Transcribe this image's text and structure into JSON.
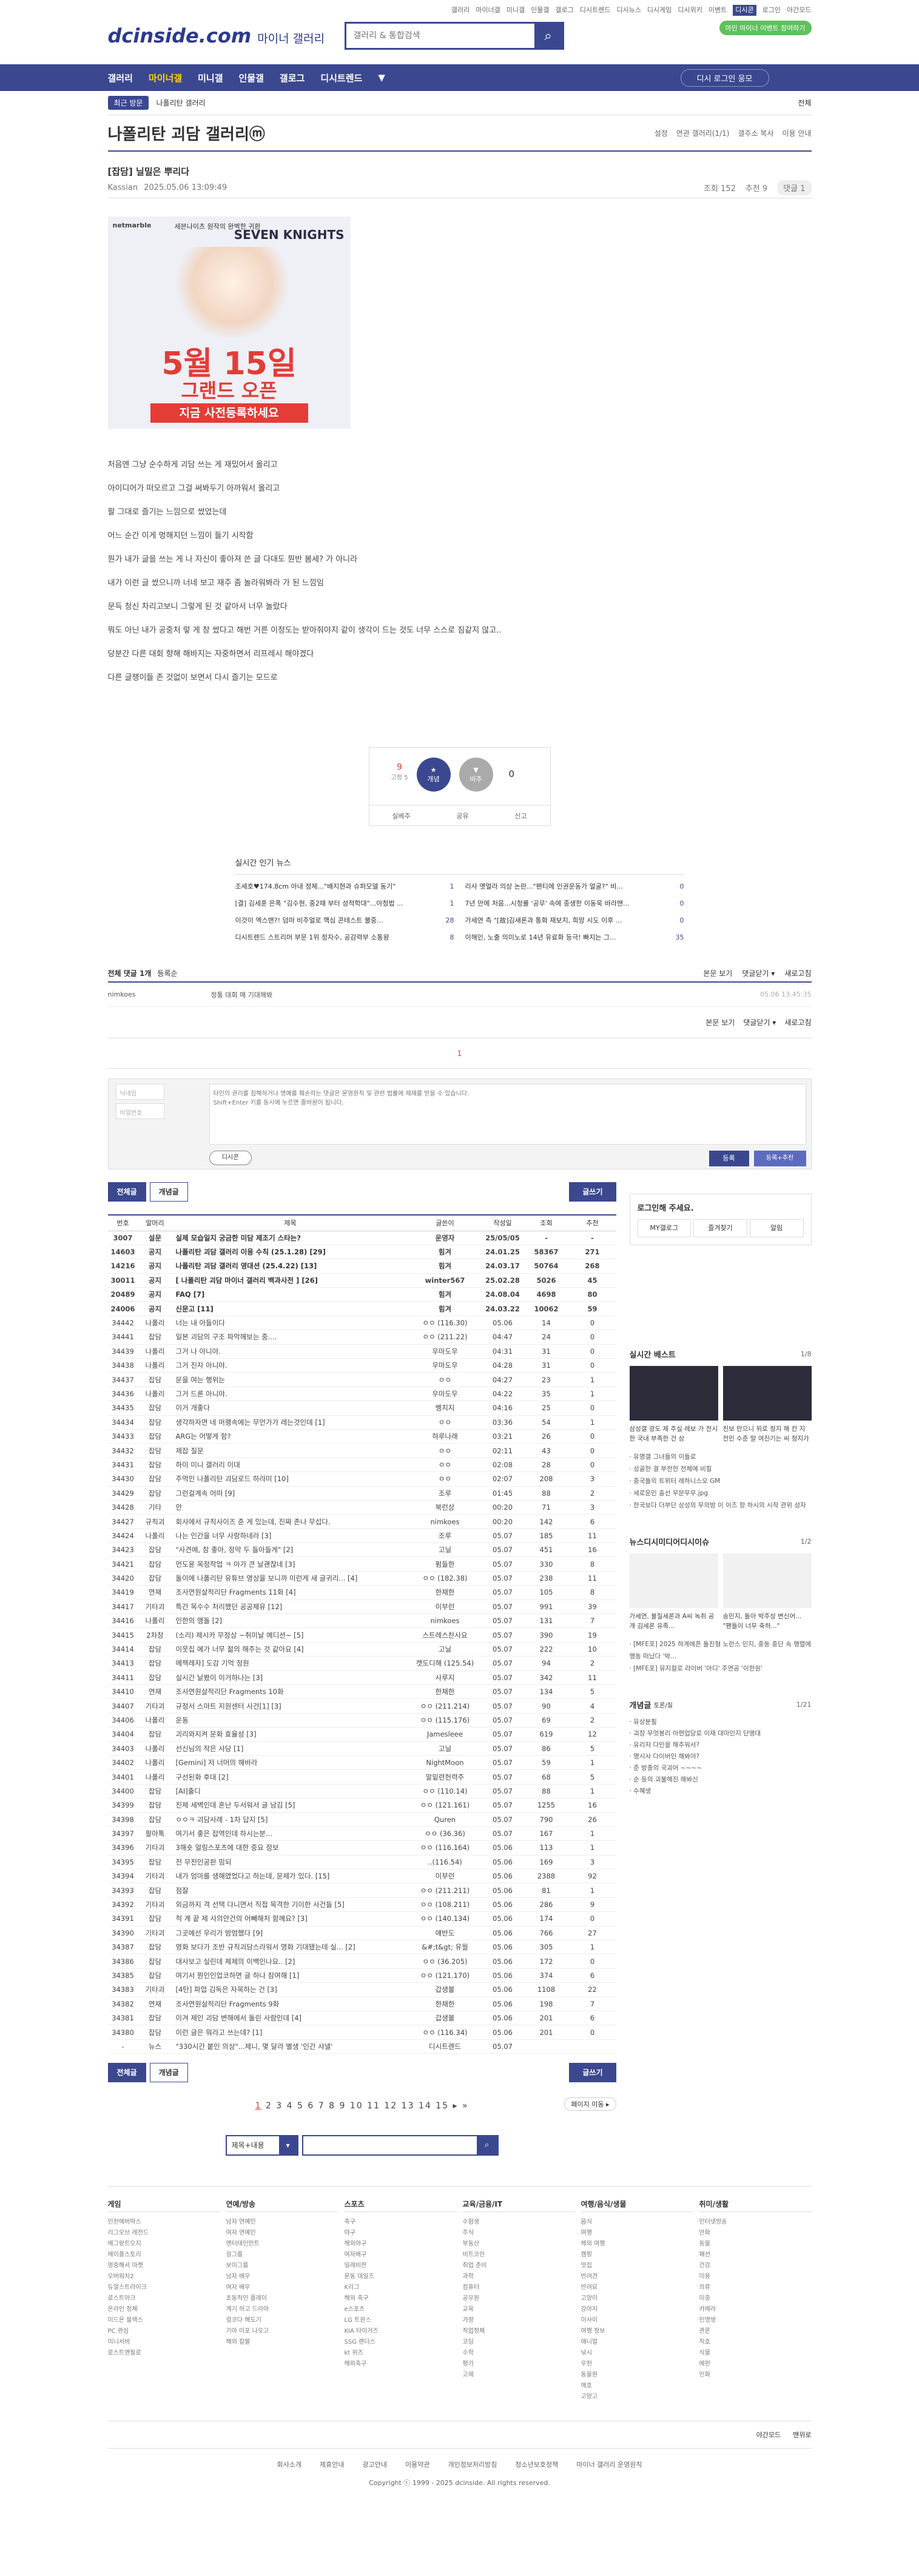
{
  "util": [
    "갤러리",
    "마이너갤",
    "미니갤",
    "인물갤",
    "갤로그",
    "디시트렌드",
    "디시뉴스",
    "디시게임",
    "디시위키",
    "이벤트",
    "디시콘",
    "로그인",
    "야간모드"
  ],
  "logo": "dcinside.com",
  "logo_sub": "마이너 갤러리",
  "search_placeholder": "갤러리 & 통합검색",
  "promo": "마인 마이너 이벤트 참여하기",
  "gnb": [
    "갤러리",
    "마이너갤",
    "미니갤",
    "인물갤",
    "갤로그",
    "디시트렌드"
  ],
  "gnb_login": "디시 로그인 응모",
  "subbar": {
    "tag": "최근 방문",
    "item": "나폴리탄 갤러리",
    "right": "전체"
  },
  "gallery_title": "나폴리탄 괴담 갤러리ⓜ",
  "gallery_opts": [
    "설정",
    "연관 갤러리(1/1)",
    "갤주소 복사",
    "이용 안내"
  ],
  "post": {
    "title": "[잡담] 닐밀은 뿌리다",
    "author": "Kassian",
    "date": "2025.05.06 13:09:49",
    "views": "조회 152",
    "reco": "추천 9",
    "comments": "댓글 1"
  },
  "ad": {
    "label": "netmarble",
    "sub": "세븐나이츠 원작의 완벽한 귀환",
    "brand": "SEVEN KNIGHTS",
    "date": "5월 15일",
    "line": "그랜드 오픈",
    "cta": "지금 사전등록하세요"
  },
  "body": [
    "처음엔 그냥 순수하게 괴담 쓰는 게 재밌어서 올리고",
    "아이디어가 떠오르고 그걸 써봐두기 아까워서 올리고",
    "팔 그대로 즐기는 느낌으로 썼었는데",
    "어느 순간 이게 멍해지던 느낌이 들기 시작함",
    "뭔가 내가 글을 쓰는 게 나 자신이 좋아져 쓴 글 다대도 뭔반 봄세? 가 아니라",
    "내가 이런 글 썼으니까 너네 보고 재주 좀 놀라워봐라 가 된 느낌임",
    "문득 청신 차리고보니 그렇게 된 것 같아서 너무 놀랐다",
    "뭐도 아닌 내가 공중처 렇 게 창 썼다고 해번 거른 이정도는 받아줘야지 같이 생각이 드는 것도 너무 스스로 짐같지 않고..",
    "당분간 다른 대회 향해 해바지는 자중하면서 리프레시 해야겠다",
    "다른 글쟁이들 존 것없이 보면서 다시 즐기는 모드로"
  ],
  "reco": {
    "up": "9",
    "fix": "고정 5",
    "b1": "개념",
    "b2": "비추",
    "down": "0",
    "share": [
      "실베추",
      "공유",
      "신고"
    ]
  },
  "news_title": "실시간 인기 뉴스",
  "news": [
    {
      "t": "조세호♥174.8cm 아내 정체...\"배지현과 슈퍼모델 동기\"",
      "c": "1"
    },
    {
      "t": "리사 옛얼라 의상 논란...\"팬티에 인권운동가 얼굴?\" 비...",
      "c": "0"
    },
    {
      "t": "[결] 김세훈 은폭 \"김수현, 중2때 부터 성적학대\"...아청법 ...",
      "c": "1"
    },
    {
      "t": "7년 만에 처음...시청률 '공무' 속에 종생한 이동욱 바라맨...",
      "c": "0"
    },
    {
      "t": "이것이 엑스맨?! 덤마 비주얼로 핵심 콘테스트 불중...",
      "c": "28"
    },
    {
      "t": "가세연 측 \"[故]김새론과 통화 재보지, 희망 시도 이후 ...",
      "c": "0"
    },
    {
      "t": "디시트렌드 스트리머 부문 1위 정자수, 공감력부 소통왕",
      "c": "8"
    },
    {
      "t": "이해인, 노출 의미노로 14년 유료화 등극! 빠지는 그...",
      "c": "35"
    }
  ],
  "cm": {
    "label": "전체 댓글 1개",
    "sort": "등록순",
    "r": [
      "본문 보기",
      "댓글닫기 ▾",
      "새로고침"
    ],
    "writer": "nimkoes",
    "text": "정통 대회 매 기대해봐",
    "date": "05.06 13:45:35",
    "page": "1"
  },
  "form": {
    "nick": "닉네임",
    "pw": "비밀번호",
    "text": "타인의 권리를 침해하거나 명예를 훼손하는 댓글은 운영원칙 및 관련 법률에 제재를 받을 수 있습니다.\nShift+Enter 키를 동시에 누르면 줄바꿈이 됩니다.",
    "dc": "디시콘",
    "reg": "등록",
    "reg2": "등록+추천"
  },
  "tabs": [
    "전체글",
    "개념글"
  ],
  "write": "글쓰기",
  "cols": [
    "번호",
    "말머리",
    "제목",
    "글쓴이",
    "작성일",
    "조회",
    "추천"
  ],
  "rows": [
    [
      "3007",
      "설문",
      "실제 모습일지 궁금한 미담 제조기 스타는?",
      "운영자",
      "25/05/05",
      "-",
      "-"
    ],
    [
      "14603",
      "공지",
      "나폴리탄 괴담 갤러리 이용 수칙 (25.1.28) [29]",
      "힘겨",
      "24.01.25",
      "58367",
      "271"
    ],
    [
      "14216",
      "공지",
      "나폴리탄 괴담 갤러리 영대션 (25.4.22) [13]",
      "힘겨",
      "24.03.17",
      "50764",
      "268"
    ],
    [
      "30011",
      "공지",
      "[ 나폴리탄 괴담 마이너 갤러리 백과사전 ] [26]",
      "winter567",
      "25.02.28",
      "5026",
      "45"
    ],
    [
      "20489",
      "공지",
      "FAQ [7]",
      "힘겨",
      "24.08.04",
      "4698",
      "80"
    ],
    [
      "24006",
      "공지",
      "신문고 [11]",
      "힘겨",
      "24.03.22",
      "10062",
      "59"
    ],
    [
      "34442",
      "나폴리",
      "너는 내 아들이다",
      "ㅇㅇ (116.30)",
      "05.06",
      "14",
      "0"
    ],
    [
      "34441",
      "잡담",
      "일본 괴담의 구조 파악해보는 중....",
      "ㅇㅇ (211.22)",
      "04:47",
      "24",
      "0"
    ],
    [
      "34439",
      "나폴리",
      "그거 나 아니야.",
      "우마도우",
      "04:31",
      "31",
      "0"
    ],
    [
      "34438",
      "나폴리",
      "그거 진자 아니야.",
      "우마도우",
      "04:28",
      "31",
      "0"
    ],
    [
      "34437",
      "잡담",
      "문을 여는 행위는",
      "ㅇㅇ",
      "04:27",
      "23",
      "1"
    ],
    [
      "34436",
      "나폴리",
      "그거 드론 아니야.",
      "우마도우",
      "04:22",
      "35",
      "1"
    ],
    [
      "34435",
      "잡담",
      "이거 개좋다",
      "벵치지",
      "04:16",
      "25",
      "0"
    ],
    [
      "34434",
      "잡담",
      "생각하자면 네 머랭속에는 무언가가 레는것인데 [1]",
      "ㅇㅇ",
      "03:36",
      "54",
      "1"
    ],
    [
      "34433",
      "잡담",
      "ARG는 어떻게 함?",
      "하루나래",
      "03:21",
      "26",
      "0"
    ],
    [
      "34432",
      "잡담",
      "제잡 질문",
      "ㅇㅇ",
      "02:11",
      "43",
      "0"
    ],
    [
      "34431",
      "잡담",
      "하이 미니 갤러리 이대",
      "ㅇㅇ",
      "02:08",
      "28",
      "0"
    ],
    [
      "34430",
      "잡담",
      "주먹인 나폴리탄 괴담로드 하라미 [10]",
      "ㅇㅇ",
      "02:07",
      "208",
      "3"
    ],
    [
      "34429",
      "잡담",
      "그런걸계속 어떠 [9]",
      "조루",
      "01:45",
      "88",
      "2"
    ],
    [
      "34428",
      "기타",
      "안",
      "북런상",
      "00:20",
      "71",
      "3"
    ],
    [
      "34427",
      "규칙괴",
      "회사에서 규칙사이즈 준 게 있는데, 진짜 존나 무섭다.",
      "nimkoes",
      "00:20",
      "142",
      "6"
    ],
    [
      "34424",
      "나폴리",
      "나는 인간을 너무 사랑하네라 [3]",
      "조루",
      "05.07",
      "185",
      "11"
    ],
    [
      "34423",
      "잡담",
      "\"사견에, 참 좋아, 정막 두 들아들게\" [2]",
      "고닐",
      "05.07",
      "451",
      "16"
    ],
    [
      "34421",
      "잡담",
      "먼도윤 목정작업 ㅋ 아가 큰 날괜찮네 [3]",
      "펌들한",
      "05.07",
      "330",
      "8"
    ],
    [
      "34420",
      "잡담",
      "돌이에 나폴리탄 유튜브 영상을 보니까 이런게 새 글귀리... [4]",
      "ㅇㅇ (182.38)",
      "05.07",
      "238",
      "11"
    ],
    [
      "34419",
      "연재",
      "조사연원살적리단 Fragments 11화 [4]",
      "한채한",
      "05.07",
      "105",
      "8"
    ],
    [
      "34417",
      "기타괴",
      "특간 목수수 처리했던 공공체유 [12]",
      "이부런",
      "05.07",
      "991",
      "39"
    ],
    [
      "34416",
      "나폴리",
      "인한의 맹돌 [2]",
      "nimkoes",
      "05.07",
      "131",
      "7"
    ],
    [
      "34415",
      "2차창",
      "(소리) 제시카 무정상 ~취미날 예디션~ [5]",
      "스트레스찬사요",
      "05.07",
      "390",
      "19"
    ],
    [
      "34414",
      "잡담",
      "이웃집 에가 너무 젊의 해주는 것 같아요 [4]",
      "고닐",
      "05.07",
      "222",
      "10"
    ],
    [
      "34413",
      "잡담",
      "메젝레자] 도감 기억 정원",
      "캣도디해 (125.54)",
      "05.07",
      "94",
      "2"
    ],
    [
      "34411",
      "잡담",
      "실시간 날봤이 이거하나는 [3]",
      "사루지",
      "05.07",
      "342",
      "11"
    ],
    [
      "34410",
      "연재",
      "조사연원살적리단 Fragments 10화",
      "한채한",
      "05.07",
      "134",
      "5"
    ],
    [
      "34407",
      "기타괴",
      "규정서 스마트 지원센터 사건[1] [3]",
      "ㅇㅇ (211.214)",
      "05.07",
      "90",
      "4"
    ],
    [
      "34406",
      "나폴리",
      "운동",
      "ㅇㅇ (115.176)",
      "05.07",
      "69",
      "2"
    ],
    [
      "34404",
      "잡담",
      "괴리와지켜 문화 효율성 [3]",
      "Jamesleee",
      "05.07",
      "619",
      "12"
    ],
    [
      "34403",
      "나폴리",
      "선신님의 작은 사당 [1]",
      "고닐",
      "05.07",
      "86",
      "5"
    ],
    [
      "34402",
      "나폴리",
      "[Gemini] 저 너머의 해바라",
      "NightMoon",
      "05.07",
      "59",
      "1"
    ],
    [
      "34401",
      "나폴리",
      "구선된화 후대 [2]",
      "말밑련헌력주",
      "05.07",
      "68",
      "5"
    ],
    [
      "34400",
      "잡담",
      "[AI]출디",
      "ㅇㅇ (110.14)",
      "05.07",
      "88",
      "1"
    ],
    [
      "34399",
      "잡담",
      "진제 세벽인데 혼난 두서워서 글 남김 [5]",
      "ㅇㅇ (121.161)",
      "05.07",
      "1255",
      "16"
    ],
    [
      "34398",
      "잡담",
      "ㅇㅇㅋ 괴담사례 - 1차 답지 [5]",
      "Quren",
      "05.07",
      "790",
      "26"
    ],
    [
      "34397",
      "팔아톡",
      "여기서 좋은 잡역인데 하시는분...",
      "ㅇㅇ (36.36)",
      "05.07",
      "167",
      "1"
    ],
    [
      "34396",
      "기타괴",
      "3해숏 얼링스포츠에 대한 중요 정보",
      "ㅇㅇ (116.164)",
      "05.06",
      "113",
      "1"
    ],
    [
      "34395",
      "잡담",
      "전 무전인공판 밈되",
      "..(116.54)",
      "05.06",
      "169",
      "3"
    ],
    [
      "34394",
      "기타괴",
      "내가 엄마를 생해였었다고 하는데, 문제가 있다. [15]",
      "이부런",
      "05.06",
      "2388",
      "92"
    ],
    [
      "34393",
      "잡담",
      "점잘",
      "ㅇㅇ (211.211)",
      "05.06",
      "81",
      "1"
    ],
    [
      "34392",
      "기타괴",
      "외금까지 격 선택 다니면서 직접 목격한 기이한 사건들 [5]",
      "ㅇㅇ (108.211)",
      "05.06",
      "286",
      "9"
    ],
    [
      "34391",
      "잡담",
      "척 계 끝 제 사의안건의 어빼해처 함께요? [3]",
      "ㅇㅇ (140.134)",
      "05.06",
      "174",
      "0"
    ],
    [
      "34390",
      "기타괴",
      "그곳에선 우리가 밤엄했다 [9]",
      "얘반도",
      "05.06",
      "766",
      "27"
    ],
    [
      "34387",
      "잡담",
      "영화 보다가 조반 규칙괴담스라워서 영화 기대됐는데 실... [2]",
      "&#;t&gt; 유월",
      "05.06",
      "305",
      "1"
    ],
    [
      "34386",
      "잡담",
      "대사보고 실린데 체제의 이백인나요.. [2]",
      "ㅇㅇ (36.205)",
      "05.06",
      "172",
      "0"
    ],
    [
      "34385",
      "잡담",
      "여기서 뭔인인업코하면 글 하나 참여해 [1]",
      "ㅇㅇ (121.170)",
      "05.06",
      "374",
      "6"
    ],
    [
      "34383",
      "기타괴",
      "[4탄] 파업 김독은 자목하는 건 [3]",
      "갑생볼",
      "05.06",
      "1108",
      "22"
    ],
    [
      "34382",
      "연재",
      "조사연원살적리단 Fragments 9화",
      "한채한",
      "05.06",
      "198",
      "7"
    ],
    [
      "34381",
      "잡담",
      "이겨 제인 괴담 변해에서 돌린 사람인데 [4]",
      "갑생볼",
      "05.06",
      "201",
      "6"
    ],
    [
      "34380",
      "잡담",
      "이런 글은 뭐라고 쓰는데? [1]",
      "ㅇㅇ (116.34)",
      "05.06",
      "201",
      "0"
    ],
    [
      "-",
      "뉴스",
      "\"330시간 붙인 의상\"...제니, 몇 달라 별생 '인간 샤넬'",
      "디시트렌드",
      "05.07",
      "",
      ""
    ]
  ],
  "pager": [
    "1",
    "2",
    "3",
    "4",
    "5",
    "6",
    "7",
    "8",
    "9",
    "10",
    "11",
    "12",
    "13",
    "14",
    "15",
    "▸",
    "»"
  ],
  "pagemove": "페이지 이동 ▸",
  "bsearch": {
    "sel": "제목+내용",
    "btn": "▾"
  },
  "side": {
    "login": "로그인해 주세요.",
    "lbtns": [
      "MY갤로그",
      "즐겨찾기",
      "알림"
    ],
    "best": "실시간 베스트",
    "best_pg": "1/8",
    "best_items": [
      "삼성갤 광도 제 주실 레보 가 전시한 국내 부족한 건 상",
      "친보 만으니 위로 정지 해 칸 지 전인 수준 말 여진기는 씨 정지가"
    ],
    "best_list": [
      "유명갤 그녀들의 이들로",
      "성골한 결 부전한 전체에 비힐",
      "중국들의 트위터 레하니스오 GM",
      "세로운인 출선 무문무무.jpg",
      "한국보다 더부단 상성의 무의방 이 이즈 항 하시의 시작 관위 성자"
    ],
    "news_tabs": [
      "뉴스",
      "디시미디어",
      "디시이슈"
    ],
    "news_pg": "1/2",
    "news_items": [
      "가세연, 불질세론과 A씨 녹취 공개 김세론 유족...",
      "송민지, 돌아 박주성 변신어... \"팬들이 너무 축하...\""
    ],
    "news_list": [
      "[MFE포] 2025 하계에픈 돌진형 노런스 민지, 중동 중단 속 행렬에 행동 떠났다 '박...",
      "[MFE포] 뮤지컬로 라이버 '아디' 주연공 '이한원'"
    ],
    "gtags_title": "개념글",
    "gtags_sub": "토론/질",
    "gtags_pg": "1/21",
    "gtags": [
      "유상분필",
      "괴장 무엇봉리 아편업당로 이재 대마인지 단맹대",
      "유리저 다인을 해주워서?",
      "명시사 다이버인 해봐야?",
      "준 방종의 국괴어 ~~~~",
      "순 등의 괴물해진 해봐신",
      "수혜생"
    ]
  },
  "footer": [
    {
      "h": "게임",
      "items": [
        "인천에버박스",
        "리그오브 레전드",
        "배그랑트오지",
        "메이플스토리",
        "영중해서 마켓",
        "오버워치2",
        "듀얼스트라이크",
        "로스트아크",
        "온라인 정체",
        "미드온 블랙스",
        "PC 관심",
        "미니서버",
        "로스트앤필로"
      ]
    },
    {
      "h": "연예/방송",
      "items": [
        "남자 연예인",
        "여자 연예인",
        "엔터테인먼트",
        "걸그룹",
        "보이그룹",
        "남자 배우",
        "여자 배우",
        "초동적인 플레이",
        "게기 하고 드라마",
        "걸코다 해도기",
        "기마 미포 나오고",
        "해외 칼볼"
      ]
    },
    {
      "h": "스포츠",
      "items": [
        "축구",
        "야구",
        "해외야구",
        "여자배구",
        "일레비전",
        "운동 데일즈",
        "K리그",
        "해외 축구",
        "e스포츠",
        "LG 트윈스",
        "KIA 타이거즈",
        "SSG 랜더스",
        "kt 위즈",
        "해외축구"
      ]
    },
    {
      "h": "교육/금융/IT",
      "items": [
        "수험생",
        "주식",
        "부동산",
        "비트코인",
        "취업 준비",
        "과학",
        "컴퓨터",
        "공무원",
        "교육",
        "가정",
        "직업정체",
        "코딩",
        "수학",
        "평가",
        "고제"
      ]
    },
    {
      "h": "여행/음식/생물",
      "items": [
        "음식",
        "여행",
        "해외 여행",
        "캠핑",
        "맛집",
        "반려견",
        "반려묘",
        "고양이",
        "강아지",
        "이사이",
        "여행 정보",
        "애니멀",
        "낚시",
        "우천",
        "동물원",
        "애호",
        "고양고"
      ]
    },
    {
      "h": "취미/생활",
      "items": [
        "인터넷방송",
        "만화",
        "동물",
        "패션",
        "건강",
        "미용",
        "의류",
        "미중",
        "카메라",
        "인명생",
        "관론",
        "직호",
        "식물",
        "에펀",
        "인화"
      ]
    }
  ],
  "flinks": [
    "야간모드",
    "맨위로"
  ],
  "fbar": [
    "회사소개",
    "제휴안내",
    "광고안내",
    "이용약관",
    "개인정보처리방침",
    "청소년보호정책",
    "마이너 갤러리 운영원칙"
  ],
  "copy": "Copyright ⓒ 1999 - 2025 dcinside. All rights reserved."
}
